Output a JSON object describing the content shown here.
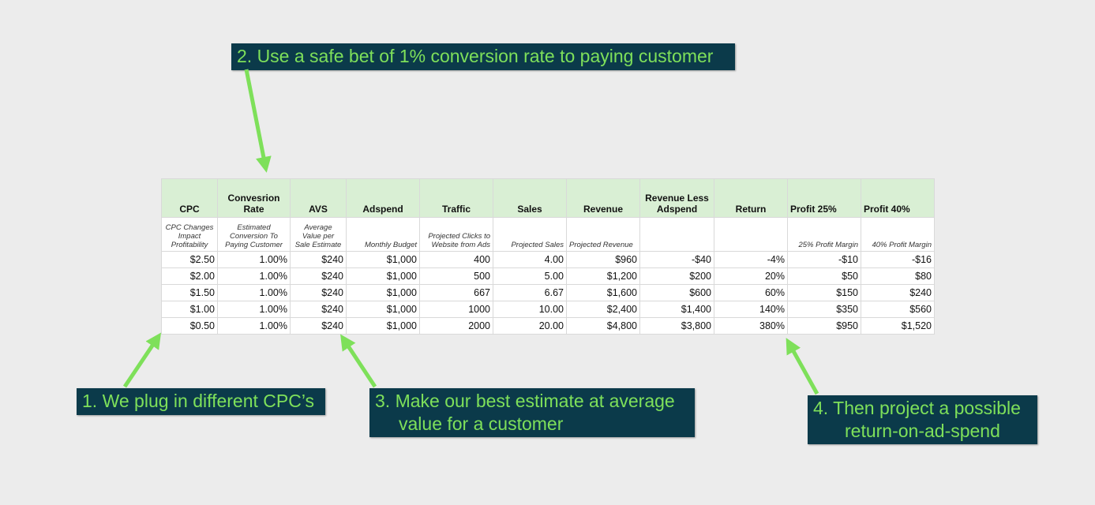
{
  "callouts": {
    "c1": "1. We plug in different CPC’s",
    "c2": "2. Use a safe bet of 1% conversion rate to paying customer",
    "c3_line1": "3. Make our best estimate at average",
    "c3_line2": "value for a customer",
    "c4_line1": "4. Then project a possible",
    "c4_line2": "return-on-ad-spend"
  },
  "colors": {
    "callout_bg": "#0b3a4a",
    "callout_text": "#7ee05a",
    "arrow": "#7ee05a",
    "header_bg": "#d9efd4"
  },
  "table": {
    "headers": [
      {
        "line1": "CPC",
        "line2": ""
      },
      {
        "line1": "Convesrion",
        "line2": "Rate"
      },
      {
        "line1": "AVS",
        "line2": ""
      },
      {
        "line1": "Adspend",
        "line2": ""
      },
      {
        "line1": "Traffic",
        "line2": ""
      },
      {
        "line1": "Sales",
        "line2": ""
      },
      {
        "line1": "Revenue",
        "line2": ""
      },
      {
        "line1": "Revenue Less",
        "line2": "Adspend"
      },
      {
        "line1": "Return",
        "line2": ""
      },
      {
        "line1": "Profit 25%",
        "line2": ""
      },
      {
        "line1": "Profit 40%",
        "line2": ""
      }
    ],
    "subheaders": [
      [
        "CPC Changes",
        "Impact",
        "Profitability"
      ],
      [
        "Estimated",
        "Conversion To",
        "Paying Customer"
      ],
      [
        "Average",
        "Value per",
        "Sale Estimate"
      ],
      [
        "Monthly Budget",
        "",
        ""
      ],
      [
        "Projected Clicks to",
        "Website from Ads",
        ""
      ],
      [
        "Projected Sales",
        "",
        ""
      ],
      [
        "Projected Revenue",
        "",
        ""
      ],
      [
        "",
        "",
        ""
      ],
      [
        "",
        "",
        ""
      ],
      [
        "25% Profit Margin",
        "",
        ""
      ],
      [
        "40% Profit Margin",
        "",
        ""
      ]
    ],
    "rows": [
      [
        "$2.50",
        "1.00%",
        "$240",
        "$1,000",
        "400",
        "4.00",
        "$960",
        "-$40",
        "-4%",
        "-$10",
        "-$16"
      ],
      [
        "$2.00",
        "1.00%",
        "$240",
        "$1,000",
        "500",
        "5.00",
        "$1,200",
        "$200",
        "20%",
        "$50",
        "$80"
      ],
      [
        "$1.50",
        "1.00%",
        "$240",
        "$1,000",
        "667",
        "6.67",
        "$1,600",
        "$600",
        "60%",
        "$150",
        "$240"
      ],
      [
        "$1.00",
        "1.00%",
        "$240",
        "$1,000",
        "1000",
        "10.00",
        "$2,400",
        "$1,400",
        "140%",
        "$350",
        "$560"
      ],
      [
        "$0.50",
        "1.00%",
        "$240",
        "$1,000",
        "2000",
        "20.00",
        "$4,800",
        "$3,800",
        "380%",
        "$950",
        "$1,520"
      ]
    ]
  }
}
